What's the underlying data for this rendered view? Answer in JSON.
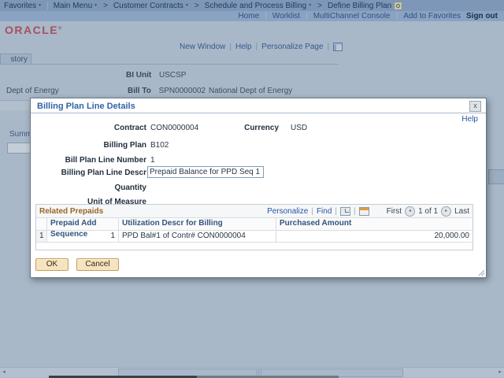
{
  "colors": {
    "link_blue": "#2456a4",
    "grid_title_brown": "#9a6426",
    "oracle_red": "#a5515f",
    "button_beige": "#f6e3bf",
    "overlay_gray_blue": "#a9b8c8"
  },
  "header": {
    "breadcrumb": {
      "favorites": "Favorites",
      "main_menu": "Main Menu",
      "crumbs": [
        "Customer Contracts",
        "Schedule and Process Billing",
        "Define Billing Plan"
      ]
    },
    "portal_links": {
      "home": "Home",
      "worklist": "Worklist",
      "multichannel": "MultiChannel Console",
      "add_to_favorites": "Add to Favorites",
      "sign_out": "Sign out"
    },
    "logo": "ORACLE"
  },
  "page_links": {
    "new_window": "New Window",
    "help": "Help",
    "personalize_page": "Personalize Page"
  },
  "background": {
    "tab_partial": "story",
    "summary_partial": "Summ",
    "left_customer": "Dept of Energy",
    "bi_unit_label": "BI Unit",
    "bi_unit_value": "USCSP",
    "bill_to_label": "Bill To",
    "bill_to_value": "SPN0000002",
    "customer_name": "National Dept of Energy"
  },
  "modal": {
    "title": "Billing Plan Line Details",
    "close": "x",
    "help": "Help",
    "contract_label": "Contract",
    "contract_value": "CON0000004",
    "currency_label": "Currency",
    "currency_value": "USD",
    "billing_plan_label": "Billing Plan",
    "billing_plan_value": "B102",
    "line_number_label": "Bill Plan Line Number",
    "line_number_value": "1",
    "descr_label": "Billing Plan Line Descr",
    "descr_value": "Prepaid Balance for PPD Seq 1",
    "quantity_label": "Quantity",
    "uom_label": "Unit of Measure",
    "grid": {
      "title": "Related Prepaids",
      "personalize": "Personalize",
      "find": "Find",
      "first": "First",
      "page_info": "1 of 1",
      "last": "Last",
      "columns": [
        "Prepaid Add Sequence",
        "Utilization Descr for Billing",
        "Purchased Amount"
      ],
      "rows": [
        {
          "row_num": "1",
          "seq": "1",
          "descr": "PPD Bal#1 of Contr# CON0000004",
          "amount": "20,000.00"
        }
      ]
    },
    "ok_label": "OK",
    "cancel_label": "Cancel"
  }
}
